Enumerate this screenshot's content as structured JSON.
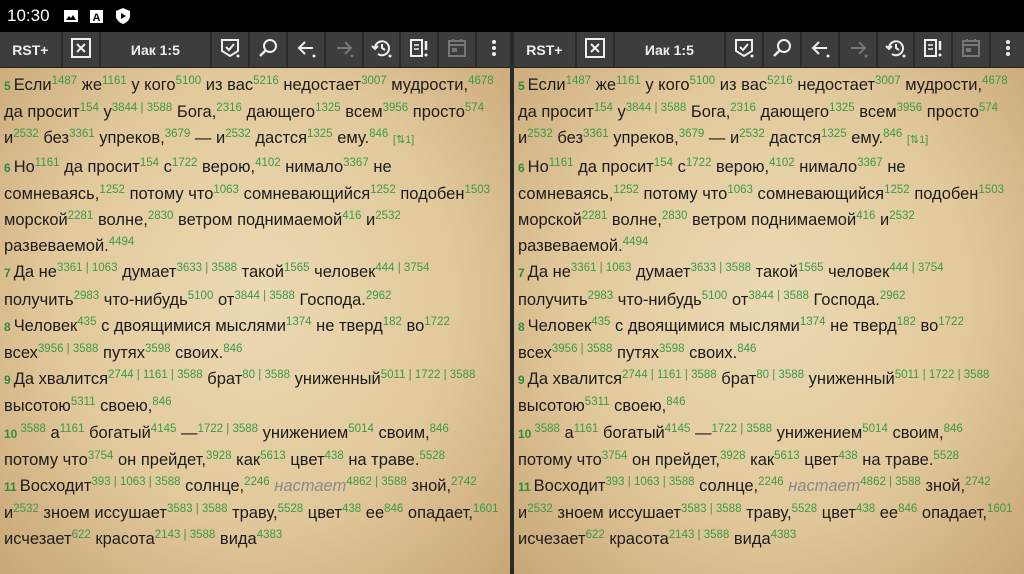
{
  "status_bar": {
    "time": "10:30",
    "icons": [
      "image-icon",
      "font-a-icon",
      "shield-play-icon"
    ]
  },
  "toolbar": {
    "translation": "RST+",
    "reference": "Иак 1:5",
    "icons": [
      "close-box-icon",
      "bookmark-check-icon",
      "search-icon",
      "back-arrow-icon",
      "forward-arrow-icon",
      "history-icon",
      "notes-icon",
      "calendar-icon",
      "more-vert-icon"
    ]
  },
  "colors": {
    "strongs": "#3a9a4a",
    "toolbar": "#3d3d3d",
    "parchment": "#e6d1a6"
  },
  "verses": [
    {
      "num": "5",
      "tokens": [
        [
          "Если",
          "1487"
        ],
        [
          "же",
          "1161"
        ],
        [
          "у кого",
          "5100"
        ],
        [
          "из вас",
          "5216"
        ],
        [
          "недостает",
          "3007"
        ],
        [
          "мудрости,",
          "4678"
        ],
        [
          "да просит",
          "154"
        ],
        [
          "у",
          "3844 | 3588"
        ],
        [
          "Бога,",
          "2316"
        ],
        [
          "дающего",
          "1325"
        ],
        [
          "всем",
          "3956"
        ],
        [
          "просто",
          "574"
        ],
        [
          "и",
          "2532"
        ],
        [
          "без",
          "3361"
        ],
        [
          "упреков,",
          "3679"
        ],
        [
          "— и",
          "2532"
        ],
        [
          "дастся",
          "1325"
        ],
        [
          "ему.",
          "846"
        ]
      ],
      "marker": "[⇅1]"
    },
    {
      "num": "6",
      "tokens": [
        [
          "Но",
          "1161"
        ],
        [
          "да просит",
          "154"
        ],
        [
          "с",
          "1722"
        ],
        [
          "верою,",
          "4102"
        ],
        [
          "нимало",
          "3367"
        ],
        [
          "не сомневаясь,",
          "1252"
        ],
        [
          "потому что",
          "1063"
        ],
        [
          "сомневающийся",
          "1252"
        ],
        [
          "подобен",
          "1503"
        ],
        [
          "морской",
          "2281"
        ],
        [
          "волне,",
          "2830"
        ],
        [
          "ветром поднимаемой",
          "416"
        ],
        [
          "и",
          "2532"
        ],
        [
          "развеваемой.",
          "4494"
        ]
      ]
    },
    {
      "num": "7",
      "tokens": [
        [
          "Да не",
          "3361 | 1063"
        ],
        [
          "думает",
          "3633 | 3588"
        ],
        [
          "такой",
          "1565"
        ],
        [
          "человек",
          "444 | 3754"
        ],
        [
          "получить",
          "2983"
        ],
        [
          "что-нибудь",
          "5100"
        ],
        [
          "от",
          "3844 | 3588"
        ],
        [
          "Господа.",
          "2962"
        ]
      ]
    },
    {
      "num": "8",
      "tokens": [
        [
          "Человек",
          "435"
        ],
        [
          "с двоящимися мыслями",
          "1374"
        ],
        [
          "не тверд",
          "182"
        ],
        [
          "во",
          "1722"
        ],
        [
          "всех",
          "3956 | 3588"
        ],
        [
          "путях",
          "3598"
        ],
        [
          "своих.",
          "846"
        ]
      ]
    },
    {
      "num": "9",
      "tokens": [
        [
          "Да хвалится",
          "2744 | 1161 | 3588"
        ],
        [
          "брат",
          "80 | 3588"
        ],
        [
          "униженный",
          "5011 | 1722 | 3588"
        ],
        [
          "высотою",
          "5311"
        ],
        [
          "своею,",
          "846"
        ]
      ]
    },
    {
      "num": "10",
      "tokens": [
        [
          "",
          "3588"
        ],
        [
          "а",
          "1161"
        ],
        [
          "богатый",
          "4145"
        ],
        [
          "—",
          "1722 | 3588"
        ],
        [
          "унижением",
          "5014"
        ],
        [
          "своим,",
          "846"
        ],
        [
          "потому что",
          "3754"
        ],
        [
          "он прейдет,",
          "3928"
        ],
        [
          "как",
          "5613"
        ],
        [
          "цвет",
          "438"
        ],
        [
          "на траве.",
          "5528"
        ]
      ]
    },
    {
      "num": "11",
      "tokens": [
        [
          "Восходит",
          "393 | 1063 | 3588"
        ],
        [
          "солнце,",
          "2246"
        ],
        [
          "настает",
          "4862 | 3588",
          "italic"
        ],
        [
          "зной,",
          "2742"
        ],
        [
          "и",
          "2532"
        ],
        [
          "зноем иссушает",
          "3583 | 3588"
        ],
        [
          "траву,",
          "5528"
        ],
        [
          "цвет",
          "438"
        ],
        [
          "ее",
          "846"
        ],
        [
          "опадает,",
          "1601"
        ],
        [
          "исчезает",
          "622"
        ],
        [
          "красота",
          "2143 | 3588"
        ],
        [
          "вида",
          "4383"
        ]
      ]
    }
  ]
}
